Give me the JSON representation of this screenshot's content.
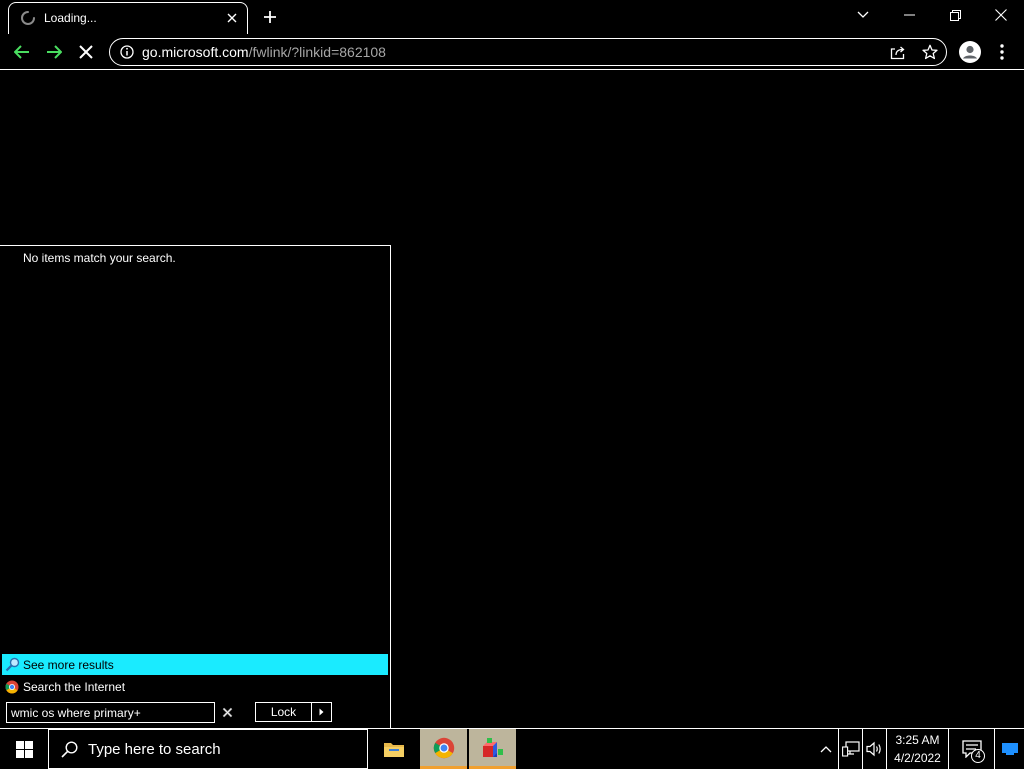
{
  "browser": {
    "tab": {
      "title": "Loading..."
    },
    "url": {
      "host": "go.microsoft.com",
      "path": "/fwlink/?linkid=862108"
    }
  },
  "start_menu": {
    "no_results": "No items match your search.",
    "see_more": "See more results",
    "search_internet": "Search the Internet",
    "search_value": "wmic os where primary+",
    "lock_label": "Lock"
  },
  "taskbar": {
    "search_placeholder": "Type here to search",
    "time": "3:25 AM",
    "date": "4/2/2022",
    "notification_count": "4",
    "apps": [
      "file-explorer",
      "google-chrome",
      "app-blocks"
    ]
  },
  "colors": {
    "background": "#000000",
    "foreground": "#ffffff",
    "highlight": "#1aebff",
    "nav_arrows": "#4ade60",
    "taskbar_active": "#bdb59c",
    "taskbar_underline": "#f0a030"
  }
}
